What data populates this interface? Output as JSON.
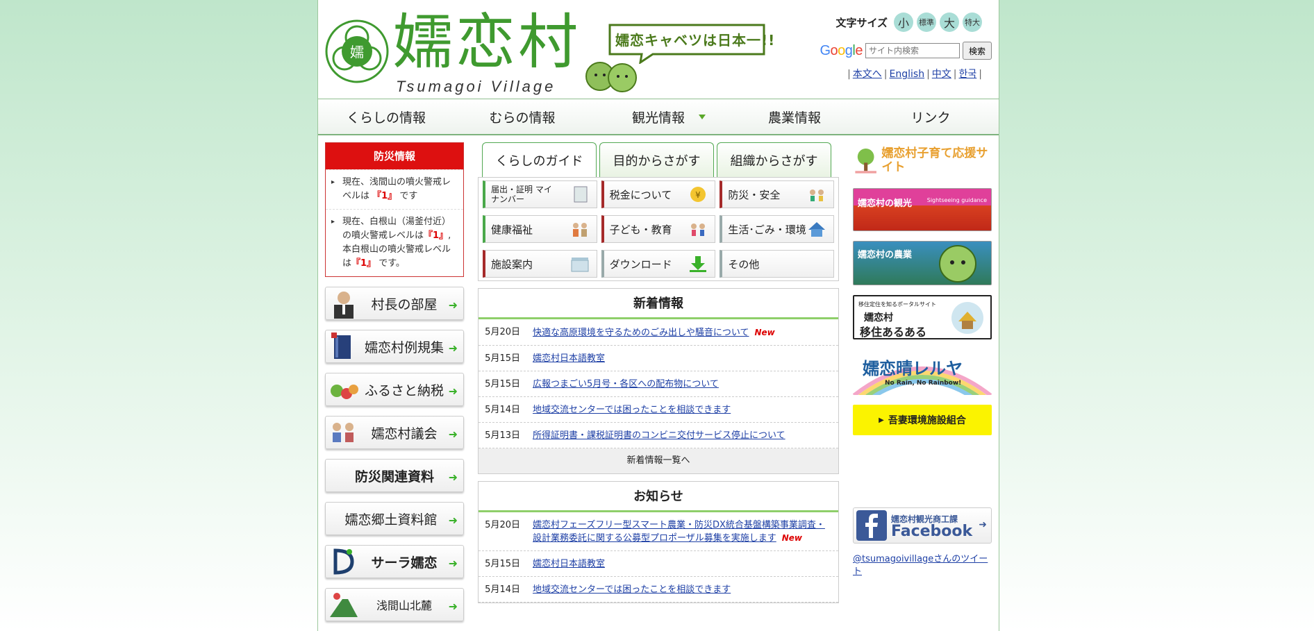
{
  "header": {
    "brand": "嬬恋村",
    "brand_sub": "Tsumagoi Village",
    "catchphrase": "嬬恋キャベツは日本一!!",
    "seal_char": "嬬",
    "font_size_label": "文字サイズ",
    "font_sizes": [
      "小",
      "標準",
      "大",
      "特大"
    ],
    "search_brand": "Google",
    "search_placeholder": "サイト内検索",
    "search_button": "検索",
    "langs": [
      "本文へ",
      "English",
      "中文",
      "한국"
    ]
  },
  "nav": [
    "くらしの情報",
    "むらの情報",
    "観光情報",
    "農業情報",
    "リンク"
  ],
  "bousai": {
    "title": "防災情報",
    "items": [
      {
        "pre": "現在、浅間山の噴火警戒レベルは",
        "level": "『1』",
        "post": "です"
      },
      {
        "pre": "現在、白根山（湯釜付近）の噴火警戒レベルは",
        "level": "『1』",
        "mid": ", 本白根山の噴火警戒レベルは",
        "level2": "『1』",
        "post": "です。"
      }
    ]
  },
  "left_banners": [
    "村長の部屋",
    "嬬恋村例規集",
    "ふるさと納税",
    "嬬恋村議会",
    "防災関連資料",
    "嬬恋郷土資料館",
    "サーラ嬬恋",
    "浅間山北麓"
  ],
  "tabs": [
    "くらしのガイド",
    "目的からさがす",
    "組織からさがす"
  ],
  "categories": [
    "届出・証明 マイナンバー",
    "税金について",
    "防災・安全",
    "健康福祉",
    "子ども・教育",
    "生活･ごみ・環境",
    "施設案内",
    "ダウンロード",
    "その他"
  ],
  "news": {
    "title": "新着情報",
    "items": [
      {
        "date": "5月20日",
        "text": "快適な高原環境を守るためのごみ出しや騒音について",
        "new": "New"
      },
      {
        "date": "5月15日",
        "text": "嬬恋村日本語教室"
      },
      {
        "date": "5月15日",
        "text": "広報つまごい5月号・各区への配布物について"
      },
      {
        "date": "5月14日",
        "text": "地域交流センターでは困ったことを相談できます"
      },
      {
        "date": "5月13日",
        "text": "所得証明書・課税証明書のコンビニ交付サービス停止について"
      }
    ],
    "more": "新着情報一覧へ"
  },
  "notice": {
    "title": "お知らせ",
    "items": [
      {
        "date": "5月20日",
        "text": "嬬恋村フェーズフリー型スマート農業・防災DX統合基盤構築事業調査・設計業務委託に関する公募型プロポーザル募集を実施します",
        "new": "New"
      },
      {
        "date": "5月15日",
        "text": "嬬恋村日本語教室"
      },
      {
        "date": "5月14日",
        "text": "地域交流センターでは困ったことを相談できます"
      }
    ]
  },
  "right": {
    "kosodate": "嬬恋村子育て応援サイト",
    "kanko": "嬬恋村の観光",
    "kanko_sub": "Sightseeing guidance",
    "nogyo": "嬬恋村の農業",
    "iju_top": "移住定住を知るポータルサイト",
    "iju_main1": "嬬恋村",
    "iju_main2": "移住あるある",
    "hareruya": "嬬恋晴レルヤ",
    "hareruya_sub": "No Rain, No Rainbow!",
    "agatsuma": "吾妻環境施設組合",
    "facebook_label": "嬬恋村観光商工課",
    "facebook_brand": "Facebook",
    "twitter": "@tsumagoivillageさんのツイート"
  },
  "colors": {
    "accent": "#3f9a2f",
    "alert": "#dd1010",
    "link": "#1d3fa5"
  }
}
